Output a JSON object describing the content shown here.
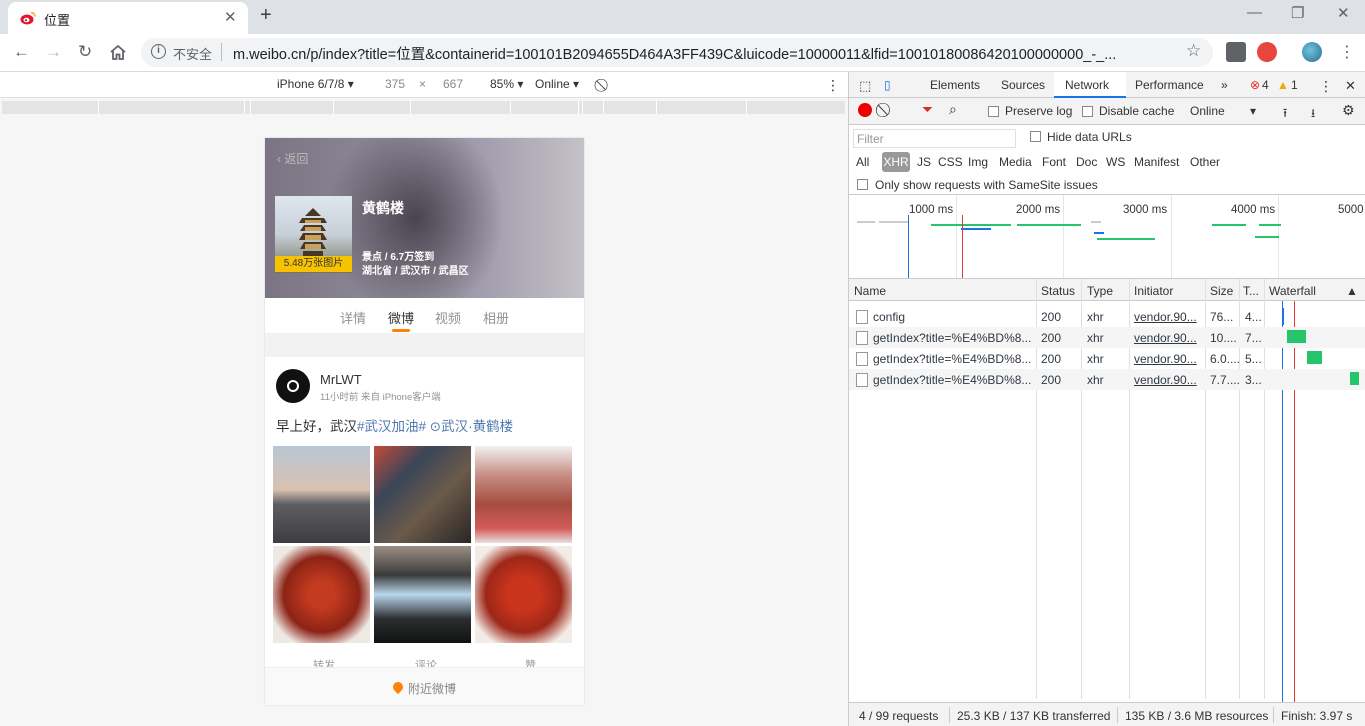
{
  "browser": {
    "tab_title": "位置",
    "tab_close": "✕",
    "new_tab": "+",
    "insecure_label": "不安全",
    "url": "m.weibo.cn/p/index?title=位置&containerid=100101B2094655D464A3FF439C&luicode=10000011&lfid=10010180086420100000000_-_..."
  },
  "device_toolbar": {
    "device": "iPhone 6/7/8",
    "width": "375",
    "times": "×",
    "height": "667",
    "zoom": "85%",
    "network": "Online"
  },
  "page": {
    "back_label": "返回",
    "place_name": "黄鹤楼",
    "photo_badge": "5.48万张图片",
    "meta_line1": "景点 / 6.7万签到",
    "meta_line2": "湖北省 / 武汉市 / 武昌区",
    "tabs": [
      "详情",
      "微博",
      "视频",
      "相册"
    ],
    "post": {
      "user": "MrLWT",
      "time": "11小时前 来自 iPhone客户端",
      "text_plain": "早上好，武汉",
      "hashtag": "#武汉加油#",
      "location": "武汉·黄鹤楼"
    },
    "actions": [
      "转发",
      "评论",
      "赞"
    ],
    "nearby": "附近微博"
  },
  "devtools": {
    "tabs": [
      "Elements",
      "Sources",
      "Network",
      "Performance"
    ],
    "active_tab": "Network",
    "more": "»",
    "errors": "4",
    "warnings": "1",
    "preserve_log": "Preserve log",
    "disable_cache": "Disable cache",
    "throttle": "Online",
    "filter_placeholder": "Filter",
    "hide_data_urls": "Hide data URLs",
    "types": [
      "All",
      "XHR",
      "JS",
      "CSS",
      "Img",
      "Media",
      "Font",
      "Doc",
      "WS",
      "Manifest",
      "Other"
    ],
    "active_type": "XHR",
    "samesite": "Only show requests with SameSite issues",
    "timeline_ticks": [
      "1000 ms",
      "2000 ms",
      "3000 ms",
      "4000 ms",
      "5000"
    ],
    "columns": [
      "Name",
      "Status",
      "Type",
      "Initiator",
      "Size",
      "T...",
      "Waterfall"
    ],
    "rows": [
      {
        "name": "config",
        "status": "200",
        "type": "xhr",
        "initiator": "vendor.90...",
        "size": "76...",
        "time": "4..."
      },
      {
        "name": "getIndex?title=%E4%BD%8...",
        "status": "200",
        "type": "xhr",
        "initiator": "vendor.90...",
        "size": "10....",
        "time": "7..."
      },
      {
        "name": "getIndex?title=%E4%BD%8...",
        "status": "200",
        "type": "xhr",
        "initiator": "vendor.90...",
        "size": "6.0....",
        "time": "5..."
      },
      {
        "name": "getIndex?title=%E4%BD%8...",
        "status": "200",
        "type": "xhr",
        "initiator": "vendor.90...",
        "size": "7.7....",
        "time": "3..."
      }
    ],
    "status": {
      "requests": "4 / 99 requests",
      "transferred": "25.3 KB / 137 KB transferred",
      "resources": "135 KB / 3.6 MB resources",
      "finish": "Finish: 3.97 s"
    },
    "colors": {
      "accent": "#1a73e8",
      "bar": "#26c46b",
      "load": "#e53935"
    }
  }
}
